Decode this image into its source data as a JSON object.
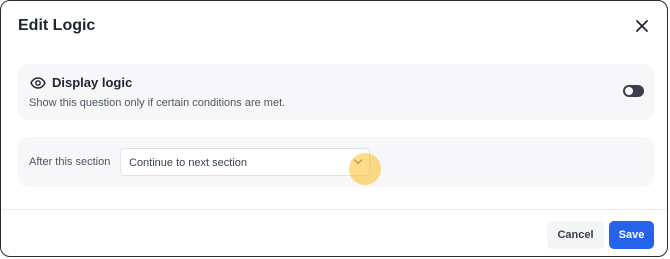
{
  "dialog": {
    "title": "Edit Logic",
    "close_icon": "close-icon"
  },
  "display_logic": {
    "icon": "eye-icon",
    "title": "Display logic",
    "description": "Show this question only if certain conditions are met.",
    "toggle_on": false
  },
  "after_section": {
    "label": "After this section",
    "selected_value": "Continue to next section",
    "dropdown_icon": "chevron-down-icon"
  },
  "footer": {
    "cancel_label": "Cancel",
    "save_label": "Save"
  },
  "colors": {
    "primary": "#2563eb",
    "card_background": "#f7f7f9",
    "toggle_track": "#3a3f4d",
    "cursor_highlight": "#fbbf24"
  }
}
